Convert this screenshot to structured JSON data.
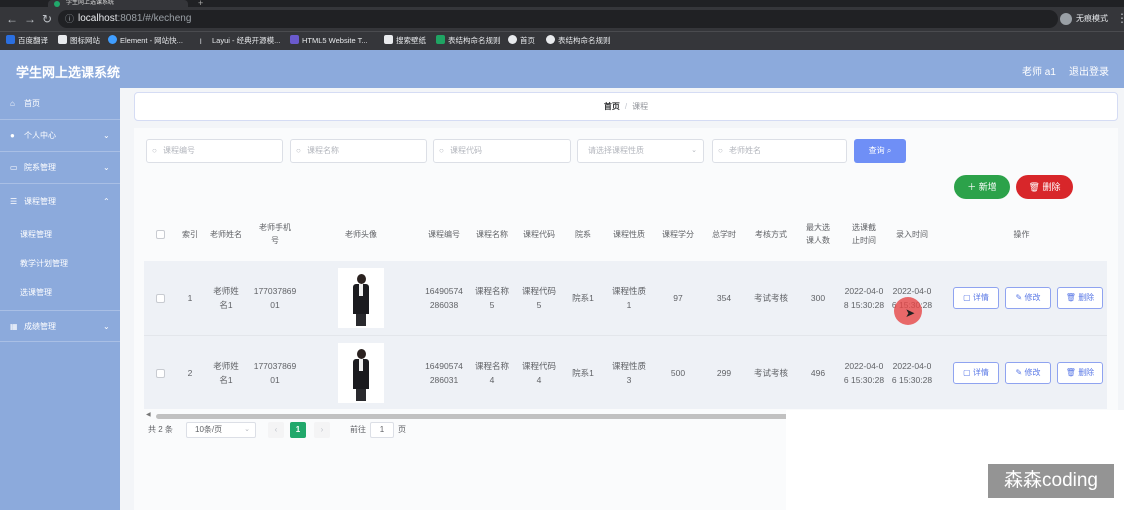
{
  "browser": {
    "tab_title": "学生网上选课系统",
    "url_host": "localhost",
    "url_rest": ":8081/#/kecheng",
    "profile_label": "无痕模式",
    "bookmarks": [
      "百度翻译",
      "图标网站",
      "Element - 网站快...",
      "Layui - 经典开源模...",
      "HTML5 Website T...",
      "搜索壁纸",
      "表结构命名规则",
      "首页",
      "表结构命名规则"
    ]
  },
  "header": {
    "app_title": "学生网上选课系统",
    "user": "老师 a1",
    "logout": "退出登录"
  },
  "sidebar": {
    "items": [
      {
        "label": "首页",
        "icon": "home-icon"
      },
      {
        "label": "个人中心",
        "icon": "user-icon"
      },
      {
        "label": "院系管理",
        "icon": "folder-icon"
      },
      {
        "label": "课程管理",
        "icon": "list-icon"
      },
      {
        "label": "成绩管理",
        "icon": "grid-icon"
      }
    ],
    "sub_items": [
      "课程管理",
      "教学计划管理",
      "选课管理"
    ]
  },
  "breadcrumb": {
    "home": "首页",
    "separator": "/",
    "current": "课程"
  },
  "search": {
    "course_no_placeholder": "课程编号",
    "course_name_placeholder": "课程名称",
    "course_code_placeholder": "课程代码",
    "nature_placeholder": "请选择课程性质",
    "teacher_placeholder": "老师姓名",
    "query_label": "查询"
  },
  "actions": {
    "add": "新增",
    "delete": "删除"
  },
  "table": {
    "headers": [
      "",
      "索引",
      "老师姓名",
      "老师手机号",
      "老师头像",
      "课程编号",
      "课程名称",
      "课程代码",
      "院系",
      "课程性质",
      "课程学分",
      "总学时",
      "考核方式",
      "最大选课人数",
      "选课截止时间",
      "录入时间",
      "操作"
    ],
    "rows": [
      {
        "index": "1",
        "teacher": "老师姓名1",
        "phone": "17703786901",
        "course_no": "16490574286038",
        "course_name": "课程名称5",
        "course_code": "课程代码5",
        "dept": "院系1",
        "nature": "课程性质1",
        "credit": "97",
        "hours": "354",
        "exam": "考试考核",
        "max": "300",
        "deadline": "2022-04-08 15:30:28",
        "created": "2022-04-06 15:30:28"
      },
      {
        "index": "2",
        "teacher": "老师姓名1",
        "phone": "17703786901",
        "course_no": "16490574286031",
        "course_name": "课程名称4",
        "course_code": "课程代码4",
        "dept": "院系1",
        "nature": "课程性质3",
        "credit": "500",
        "hours": "299",
        "exam": "考试考核",
        "max": "496",
        "deadline": "2022-04-06 15:30:28",
        "created": "2022-04-06 15:30:28"
      }
    ],
    "row_buttons": {
      "detail": "详情",
      "edit": "修改",
      "delete": "删除"
    }
  },
  "pagination": {
    "total": "共 2 条",
    "page_size": "10条/页",
    "current": "1",
    "goto": "前往",
    "goto_value": "1",
    "unit": "页"
  },
  "watermark": "森森coding",
  "colors": {
    "header_bg": "#8caadc",
    "add_button": "#2ca24a",
    "delete_button": "#d8262a",
    "query_button": "#6f8ff6",
    "page_active": "#21a86b"
  }
}
